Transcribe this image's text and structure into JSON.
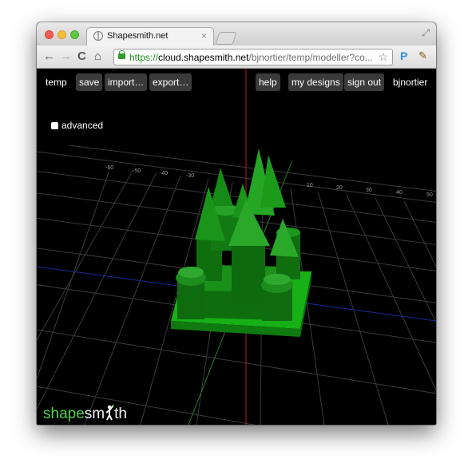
{
  "browser": {
    "tab_title": "Shapesmith.net",
    "tab_close": "×",
    "url_scheme": "https://",
    "url_host": "cloud.shapesmith.net",
    "url_path": "/bjnortier/temp/modeller?co...",
    "nav": {
      "back": "←",
      "forward": "→",
      "reload": "C",
      "home": "⌂"
    },
    "star": "☆",
    "extension_p": "P",
    "extension_wrench": "✎",
    "resize": "⤢"
  },
  "app": {
    "design_name": "temp",
    "save_label": "save",
    "import_label": "import…",
    "export_label": "export…",
    "help_label": "help",
    "my_designs_label": "my designs",
    "sign_out_label": "sign out",
    "username": "bjnortier",
    "advanced_label": "advanced",
    "logo_part1": "shape",
    "logo_part2": "sm",
    "logo_part3": "th",
    "axis_ticks": [
      "-60",
      "-50",
      "-40",
      "-30",
      "10",
      "20",
      "30",
      "40",
      "50"
    ]
  },
  "colors": {
    "model_green": "#1f9f1f",
    "model_dark": "#0d5e0d",
    "base_green": "#22cc22",
    "axis_red": "#c02020",
    "axis_blue": "#1a2a9a",
    "grid": "#3a3a3a",
    "logo_green": "#4fd34f"
  }
}
